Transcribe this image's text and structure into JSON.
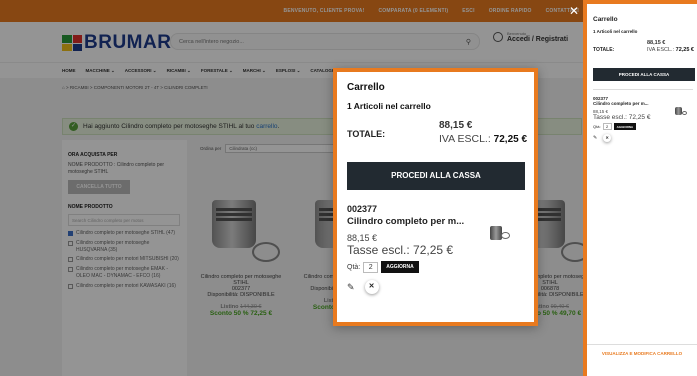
{
  "colors": {
    "accent": "#e87a1f",
    "dark_button": "#222a31",
    "discount": "#48a51f",
    "logo": "#1e3c8c"
  },
  "topbar": {
    "welcome": "BENVENUTO, CLIENTE PROVA!",
    "compare": "COMPARATA (0 ELEMENTI)",
    "logout": "ESCI",
    "quick_order": "ORDINE RAPIDO",
    "contact": "CONTATTACI"
  },
  "header": {
    "logo_text": "BRUMAR",
    "search_placeholder": "Cerca nell'intero negozio...",
    "account_small": "Benvenuto",
    "account_label": "Accedi / Registrati"
  },
  "nav": {
    "items": [
      "HOME",
      "MACCHINE ⌄",
      "ACCESSORI ⌄",
      "RICAMBI ⌄",
      "FORESTALE ⌄",
      "MARCHI ⌄",
      "ESPLOSI ⌄",
      "CATALOGHI",
      "OUTLET",
      "CONTATTI"
    ]
  },
  "breadcrumb": "⌂ > RICAMBI > COMPONENTI MOTORI 2T - 4T > CILINDRI COMPLETI",
  "notice": {
    "prefix": "Hai aggiunto Cilindro completo per motoseghe STIHL al tuo",
    "link": "carrello",
    "suffix": "."
  },
  "sidebar": {
    "heading": "ORA ACQUISTA PER",
    "active_filter": "NOME PRODOTTO : Cilindro completo per motoseghe STIHL",
    "clear_label": "CANCELLA TUTTO",
    "facet_heading": "NOME PRODOTTO",
    "facet_placeholder": "Search Cilindro completo per motos",
    "facets": [
      {
        "label": "Cilindro completo per motoseghe STIHL (47)",
        "checked": true
      },
      {
        "label": "Cilindro completo per motoseghe HUSQVARNA (35)",
        "checked": false
      },
      {
        "label": "Cilindro completo per motori MITSUBISHI (20)",
        "checked": false
      },
      {
        "label": "Cilindro completo per motoseghe EMAK - OLEO MAC - DYNAMAC - EFCO (16)",
        "checked": false
      },
      {
        "label": "Cilindro completo per motori KAWASAKI (16)",
        "checked": false
      }
    ]
  },
  "sort": {
    "label": "Ordina per",
    "value": "Cilindrata (cc)",
    "show_label": "Mostra",
    "show_value": "60"
  },
  "products": [
    {
      "name": "Cilindro completo per motoseghe STIHL",
      "sku": "002377",
      "availability": "Disponibilità: DISPONIBILE",
      "list_label": "Listino",
      "list_price": "144,30 €",
      "discount": "Sconto 50 % 72,25 €"
    },
    {
      "name": "Cilindro completo per motoseghe STIHL",
      "sku": "",
      "availability": "Disponibilità: DISPONIBILE",
      "list_label": "Listino",
      "list_price": "110,70 €",
      "discount": "Sconto 50 % 55,35 €"
    },
    {
      "name": "",
      "sku": "",
      "availability": "Disponibilità: DISPONIBILE",
      "list_label": "Listino",
      "list_price": "88,10 €",
      "discount": "Sconto 50 % 44,05 €"
    },
    {
      "name": "Cilindro completo per motoseghe STIHL",
      "sku": "006878",
      "availability": "Disponibilità: DISPONIBILE",
      "list_label": "Listino",
      "list_price": "99,40 €",
      "discount": "Sconto 50 % 49,70 €"
    }
  ],
  "modal": {
    "title": "Carrello",
    "count": "1 Articoli nel carrello",
    "total_label": "TOTALE:",
    "total": "88,15 €",
    "iva_label": "IVA ESCL.:",
    "iva_value": "72,25 €",
    "checkout": "PROCEDI ALLA CASSA",
    "item": {
      "sku": "002377",
      "name": "Cilindro completo per m...",
      "price": "88,15 €",
      "tax_label": "Tasse escl.: 72,25 €",
      "qty_label": "Qtà:",
      "qty": "2",
      "update": "AGGIORNA"
    }
  },
  "panel": {
    "title": "Carrello",
    "count": "1 Articoli nel carrello",
    "total_label": "TOTALE:",
    "total": "88,15 €",
    "iva_label": "IVA ESCL.:",
    "iva_value": "72,25 €",
    "checkout": "PROCEDI ALLA CASSA",
    "item": {
      "sku": "002377",
      "name": "Cilindro completo per m...",
      "price": "88,15 €",
      "tax_label": "Tasse escl.: 72,25 €",
      "qty_label": "Qtà:",
      "qty": "2",
      "update": "AGGIORNA"
    },
    "view_cart": "VISUALIZZA E MODIFICA CARRELLO"
  }
}
